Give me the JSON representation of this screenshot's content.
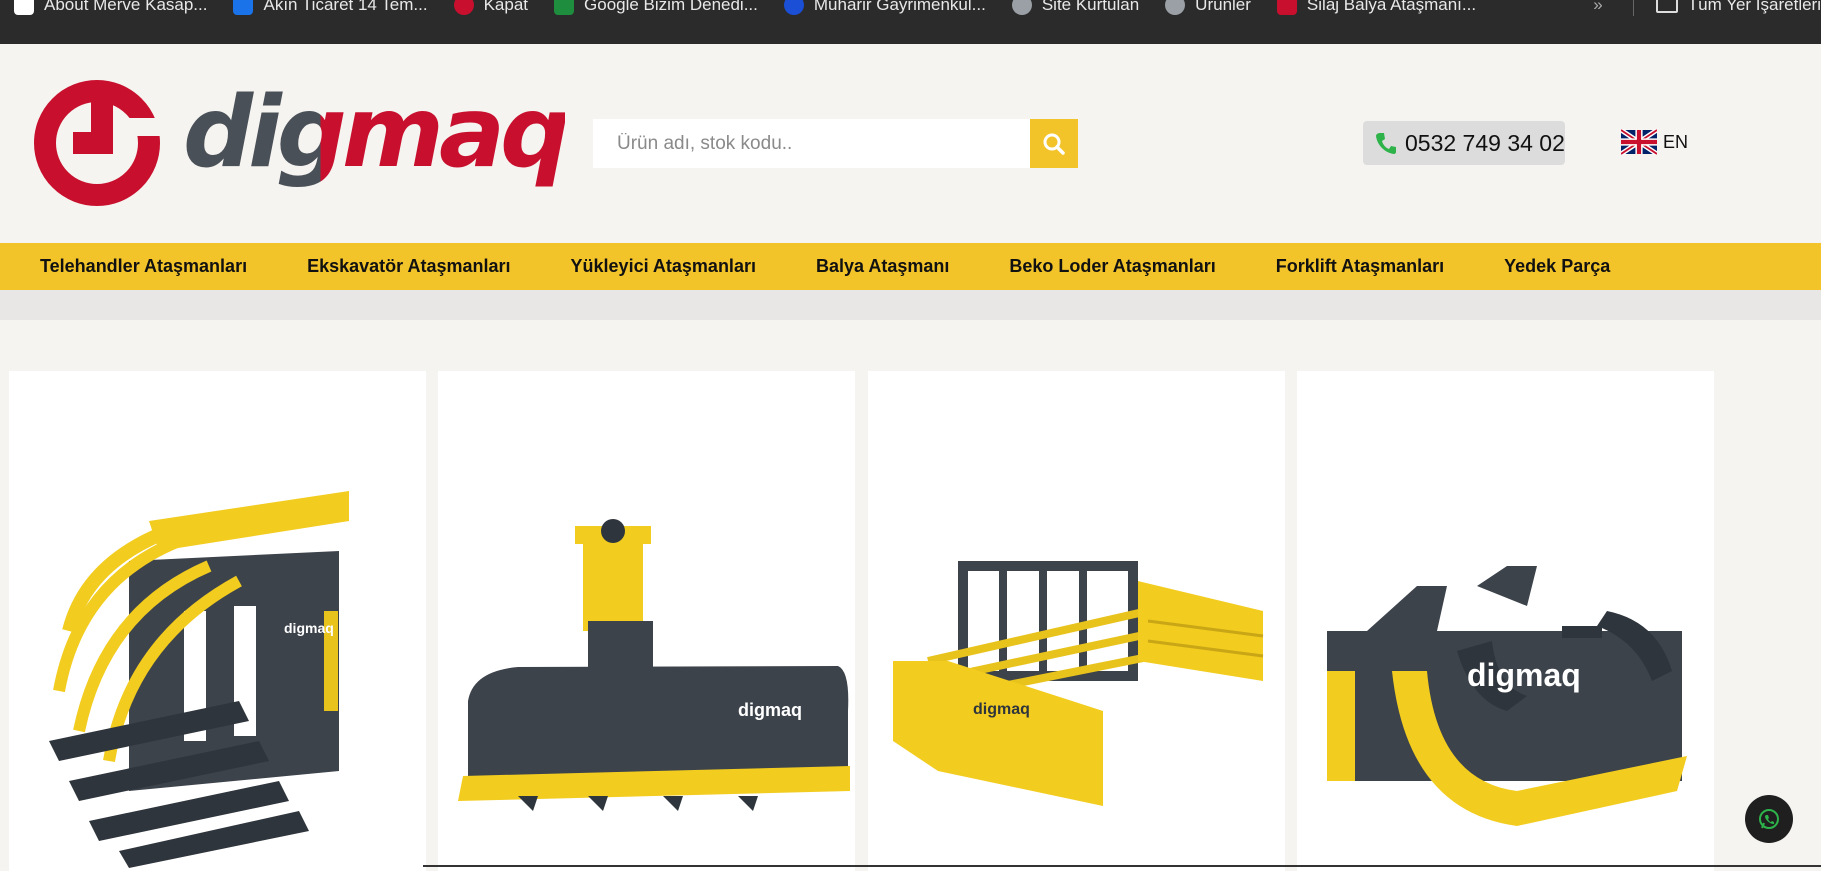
{
  "bookmarks": {
    "items": [
      {
        "label": "About Merve Kasap...",
        "icon": "page-icon",
        "color": "#ffffff"
      },
      {
        "label": "Akın Ticaret 14 Tem...",
        "icon": "site-icon",
        "color": "#1a73e8"
      },
      {
        "label": "Kapat",
        "icon": "site-icon",
        "color": "#c8102e"
      },
      {
        "label": "Google Bizim Denedi...",
        "icon": "site-icon",
        "color": "#1e8e3e"
      },
      {
        "label": "Muharir Gayrimenkul...",
        "icon": "site-icon",
        "color": "#1a4fd6"
      },
      {
        "label": "Site Kurtulan",
        "icon": "globe-icon",
        "color": "#9aa0a6"
      },
      {
        "label": "Ürünler",
        "icon": "globe-icon",
        "color": "#9aa0a6"
      },
      {
        "label": "Silaj Balya Ataşmanı...",
        "icon": "site-icon",
        "color": "#c8102e"
      }
    ],
    "overflow": "»",
    "other": "Tüm Yer İşaretleri"
  },
  "header": {
    "logo_text": "digmaq",
    "search": {
      "placeholder": "Ürün adı, stok kodu..",
      "value": ""
    },
    "phone": "0532 749 34 02",
    "language": "EN"
  },
  "nav": {
    "items": [
      "Telehandler Ataşmanları",
      "Ekskavatör Ataşmanları",
      "Yükleyici Ataşmanları",
      "Balya Ataşmanı",
      "Beko Loder Ataşmanları",
      "Forklift Ataşmanları",
      "Yedek Parça"
    ]
  },
  "products": [
    {
      "image": "bale-grab-fork-attachment",
      "brand": "digmaq"
    },
    {
      "image": "rotary-tiller-attachment",
      "brand": "digmaq"
    },
    {
      "image": "bale-squeezer-attachment",
      "brand": "digmaq"
    },
    {
      "image": "root-grapple-attachment",
      "brand": "digmaq"
    }
  ],
  "colors": {
    "accent_yellow": "#f3c42a",
    "brand_red": "#c8102e",
    "brand_gray": "#4a5058",
    "bookmarks_bg": "#2b2b2b"
  }
}
